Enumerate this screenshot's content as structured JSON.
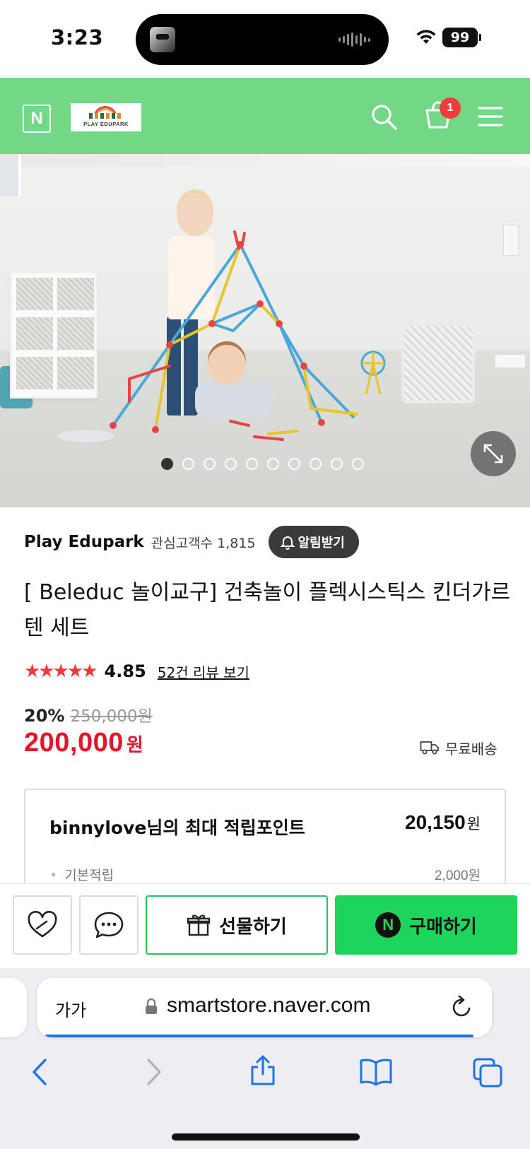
{
  "status_bar": {
    "time": "3:23",
    "battery": "99"
  },
  "header": {
    "naver_logo": "N",
    "store_logo_text": "PLAY EDUPARK",
    "cart_count": "1",
    "icons": [
      "naver-n-icon",
      "search-icon",
      "cart-icon",
      "menu-icon"
    ]
  },
  "gallery": {
    "slide_count": 10,
    "active_index": 0,
    "expand_icon": "expand-icon"
  },
  "seller": {
    "name": "Play Edupark",
    "followers_label": "관심고객수 1,815",
    "alarm_button": "알림받기"
  },
  "product": {
    "title": "[ Beleduc 놀이교구] 건축놀이 플렉시스틱스 킨더가르텐 세트",
    "rating": "4.85",
    "stars": "★★★★★",
    "review_link": "52건 리뷰 보기",
    "discount": "20%",
    "original_price": "250,000원",
    "price": "200,000",
    "currency": "원",
    "shipping": "무료배송"
  },
  "points": {
    "title": "binnylove님의 최대 적립포인트",
    "total_value": "20,150",
    "total_unit": "원",
    "basic_label": "기본적립",
    "basic_value": "2,000원"
  },
  "actions": {
    "gift": "선물하기",
    "buy": "구매하기",
    "npay_mark": "N"
  },
  "browser": {
    "text_size": "가가",
    "url": "smartstore.naver.com"
  },
  "colors": {
    "header_green": "#73d886",
    "buy_green": "#1fd45c",
    "price_red": "#e3152b",
    "star_red": "#ee3a3a",
    "badge_red": "#f03c3c"
  }
}
